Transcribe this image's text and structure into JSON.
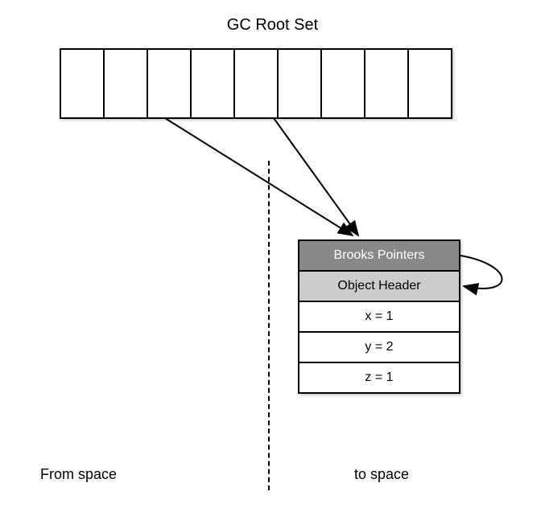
{
  "title": "GC Root Set",
  "root_set": {
    "cell_count": 9
  },
  "object": {
    "brooks_label": "Brooks Pointers",
    "header_label": "Object Header",
    "fields": [
      "x = 1",
      "y = 2",
      "z = 1"
    ]
  },
  "spaces": {
    "from": "From space",
    "to": "to space"
  }
}
